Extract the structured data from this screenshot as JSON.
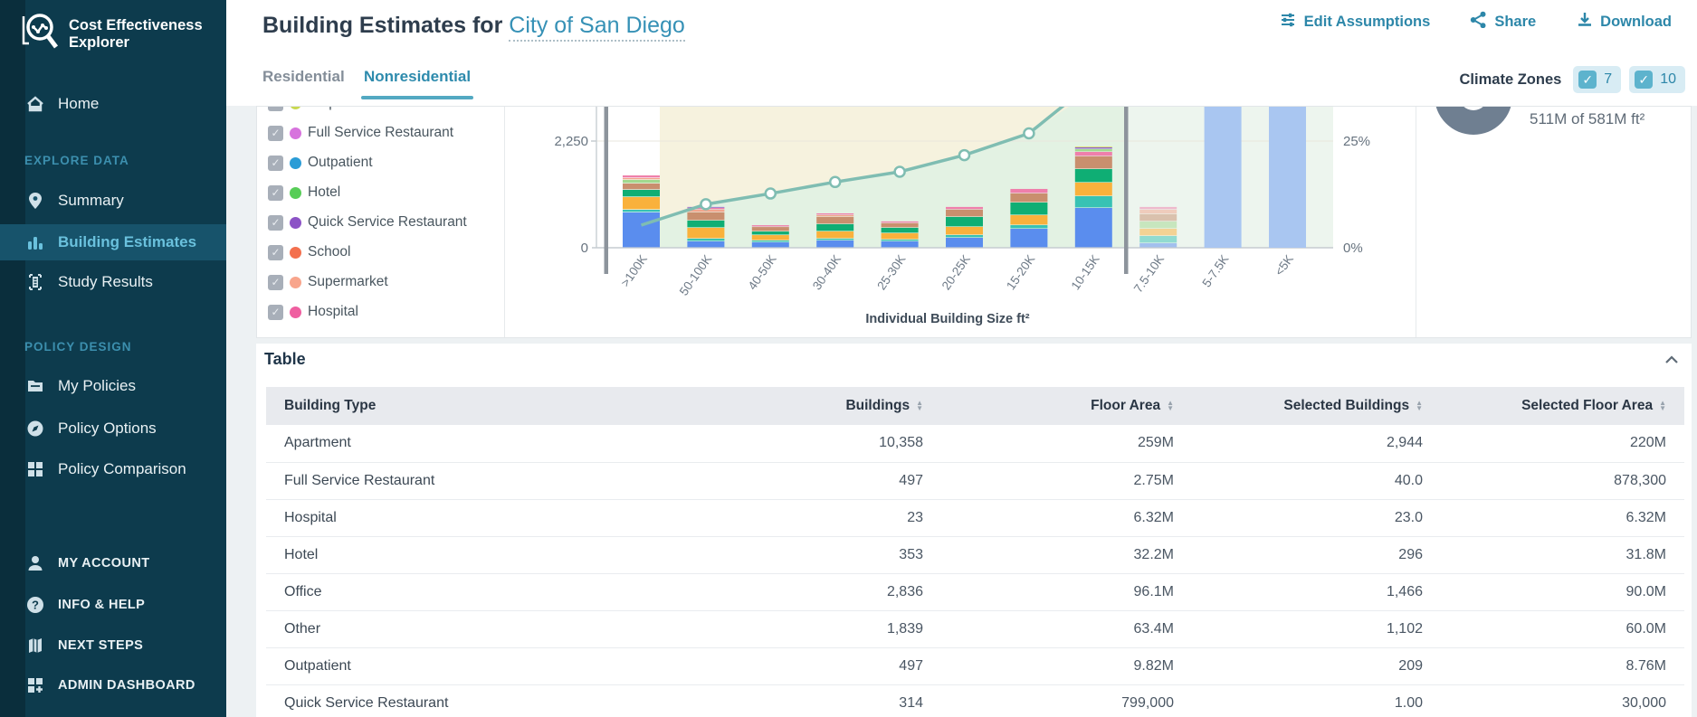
{
  "brand": {
    "line1": "Cost Effectiveness",
    "line2": "Explorer"
  },
  "sidebar": {
    "sections": [
      {
        "label": "",
        "items": [
          {
            "label": "Home",
            "icon": "home-icon",
            "active": false
          }
        ]
      },
      {
        "label": "EXPLORE DATA",
        "items": [
          {
            "label": "Summary",
            "icon": "pin-icon",
            "active": false
          },
          {
            "label": "Building Estimates",
            "icon": "bar-chart-icon",
            "active": true
          },
          {
            "label": "Study Results",
            "icon": "document-icon",
            "active": false
          }
        ]
      },
      {
        "label": "POLICY DESIGN",
        "items": [
          {
            "label": "My Policies",
            "icon": "folder-icon",
            "active": false
          },
          {
            "label": "Policy Options",
            "icon": "compass-icon",
            "active": false
          },
          {
            "label": "Policy Comparison",
            "icon": "grid-icon",
            "active": false
          }
        ]
      }
    ],
    "footer_items": [
      {
        "label": "MY ACCOUNT",
        "icon": "person-icon"
      },
      {
        "label": "INFO & HELP",
        "icon": "question-icon"
      },
      {
        "label": "NEXT STEPS",
        "icon": "map-icon"
      },
      {
        "label": "ADMIN DASHBOARD",
        "icon": "dashboard-plus-icon"
      }
    ]
  },
  "header": {
    "title": "Building Estimates for",
    "region_link": "City of San Diego",
    "actions": [
      {
        "label": "Edit Assumptions",
        "icon": "sliders-icon"
      },
      {
        "label": "Share",
        "icon": "share-icon"
      },
      {
        "label": "Download",
        "icon": "download-icon"
      }
    ]
  },
  "tabs": [
    {
      "label": "Residential",
      "active": false
    },
    {
      "label": "Nonresidential",
      "active": true
    }
  ],
  "climate_zones": {
    "label": "Climate Zones",
    "zones": [
      {
        "value": "7",
        "checked": true
      },
      {
        "value": "10",
        "checked": true
      }
    ]
  },
  "legend": {
    "items": [
      {
        "label": "Strip Mall",
        "color": "#c9d94f",
        "checked": true
      },
      {
        "label": "Full Service Restaurant",
        "color": "#d773dd",
        "checked": true
      },
      {
        "label": "Outpatient",
        "color": "#2b9cd6",
        "checked": true
      },
      {
        "label": "Hotel",
        "color": "#58cd58",
        "checked": true
      },
      {
        "label": "Quick Service Restaurant",
        "color": "#8c53c6",
        "checked": true
      },
      {
        "label": "School",
        "color": "#f3704e",
        "checked": true
      },
      {
        "label": "Supermarket",
        "color": "#f8a58c",
        "checked": true
      },
      {
        "label": "Hospital",
        "color": "#ef5fa0",
        "checked": true
      }
    ]
  },
  "chart_data": {
    "type": "bar",
    "subtype": "stacked-bars-with-cumulative-line",
    "categories": [
      ">100K",
      "50-100K",
      "40-50K",
      "30-40K",
      "25-30K",
      "20-25K",
      "15-20K",
      "10-15K",
      "7.5-10K",
      "5-7.5K",
      "<5K"
    ],
    "xlabel": "Individual Building Size ft²",
    "left_axis": {
      "ticks": [
        "0",
        "2,250"
      ],
      "values": [
        0,
        2250
      ]
    },
    "right_axis": {
      "ticks": [
        "0%",
        "25%"
      ],
      "values": [
        0,
        25
      ]
    },
    "selected_range_note": "slider handles select >100K through 10-15K; bars right of handle are deselected",
    "stack_palette": {
      "blue": "#5a8dee",
      "teal": "#38c2b4",
      "amber": "#f9b13c",
      "green": "#0fae74",
      "tan": "#c98f6e",
      "lgreen": "#a2d98f",
      "salmon": "#f2a58c",
      "pink": "#ef7fab",
      "violet": "#8a5fc9",
      "yellow": "#e0d860"
    },
    "bars": [
      {
        "category": ">100K",
        "total": 1525,
        "segments": [
          [
            "blue",
            744
          ],
          [
            "teal",
            57
          ],
          [
            "amber",
            267
          ],
          [
            "green",
            153
          ],
          [
            "tan",
            134
          ],
          [
            "lgreen",
            76
          ],
          [
            "salmon",
            38
          ],
          [
            "pink",
            56
          ]
        ]
      },
      {
        "category": "50-100K",
        "total": 860,
        "segments": [
          [
            "blue",
            134
          ],
          [
            "teal",
            57
          ],
          [
            "amber",
            229
          ],
          [
            "green",
            153
          ],
          [
            "tan",
            172
          ],
          [
            "salmon",
            57
          ],
          [
            "pink",
            38
          ],
          [
            "violet",
            20
          ]
        ]
      },
      {
        "category": "40-50K",
        "total": 475,
        "segments": [
          [
            "blue",
            114
          ],
          [
            "teal",
            38
          ],
          [
            "amber",
            114
          ],
          [
            "green",
            76
          ],
          [
            "tan",
            95
          ],
          [
            "pink",
            38
          ]
        ]
      },
      {
        "category": "30-40K",
        "total": 725,
        "segments": [
          [
            "blue",
            153
          ],
          [
            "teal",
            38
          ],
          [
            "amber",
            153
          ],
          [
            "green",
            153
          ],
          [
            "tan",
            152
          ],
          [
            "salmon",
            38
          ],
          [
            "pink",
            38
          ]
        ]
      },
      {
        "category": "25-30K",
        "total": 555,
        "segments": [
          [
            "blue",
            134
          ],
          [
            "teal",
            38
          ],
          [
            "amber",
            134
          ],
          [
            "green",
            114
          ],
          [
            "tan",
            97
          ],
          [
            "pink",
            38
          ]
        ]
      },
      {
        "category": "20-25K",
        "total": 860,
        "segments": [
          [
            "blue",
            210
          ],
          [
            "teal",
            57
          ],
          [
            "amber",
            172
          ],
          [
            "green",
            210
          ],
          [
            "tan",
            154
          ],
          [
            "pink",
            57
          ]
        ]
      },
      {
        "category": "15-20K",
        "total": 1240,
        "segments": [
          [
            "blue",
            400
          ],
          [
            "teal",
            76
          ],
          [
            "amber",
            210
          ],
          [
            "green",
            267
          ],
          [
            "tan",
            191
          ],
          [
            "pink",
            96
          ]
        ]
      },
      {
        "category": "10-15K",
        "total": 2135,
        "segments": [
          [
            "blue",
            839
          ],
          [
            "teal",
            248
          ],
          [
            "amber",
            286
          ],
          [
            "green",
            286
          ],
          [
            "tan",
            267
          ],
          [
            "pink",
            95
          ],
          [
            "lgreen",
            57
          ],
          [
            "violet",
            38
          ],
          [
            "yellow",
            19
          ]
        ]
      },
      {
        "category": "7.5-10K",
        "total": 860,
        "muted": true,
        "segments": [
          [
            "blue",
            95
          ],
          [
            "teal",
            153
          ],
          [
            "amber",
            153
          ],
          [
            "lgreen",
            153
          ],
          [
            "tan",
            153
          ],
          [
            "salmon",
            96
          ],
          [
            "pink",
            57
          ]
        ]
      },
      {
        "category": "5-7.5K",
        "total": null,
        "clipped": true
      },
      {
        "category": "<5K",
        "total": null,
        "clipped": true
      }
    ],
    "line": {
      "name": "cumulative floor area %",
      "pct_at_category": [
        5.3,
        10.2,
        12.7,
        15.4,
        17.8,
        21.7,
        26.8,
        null,
        null,
        null,
        null
      ],
      "exits_top_after_index": 6
    },
    "colors": {
      "line": "#7fbdb2",
      "selected_bg_above_line": "#f6f2de",
      "selected_bg_below_line": "#e3f2e3",
      "deselected_bg": "#edf5ee",
      "deselected_bar": "#a9c6f1",
      "handle": "#8d949c"
    }
  },
  "summary_gauge": {
    "value": 511,
    "total": 581,
    "text": "511M of 581M ft²",
    "fill_color": "#6f7f91"
  },
  "table": {
    "section_title": "Table",
    "columns": [
      {
        "label": "Building Type",
        "sortable": true,
        "align": "left"
      },
      {
        "label": "Buildings",
        "sortable": true,
        "align": "right"
      },
      {
        "label": "Floor Area",
        "sortable": true,
        "align": "right"
      },
      {
        "label": "Selected Buildings",
        "sortable": true,
        "align": "right"
      },
      {
        "label": "Selected Floor Area",
        "sortable": true,
        "align": "right"
      }
    ],
    "rows": [
      [
        "Apartment",
        "10,358",
        "259M",
        "2,944",
        "220M"
      ],
      [
        "Full Service Restaurant",
        "497",
        "2.75M",
        "40.0",
        "878,300"
      ],
      [
        "Hospital",
        "23",
        "6.32M",
        "23.0",
        "6.32M"
      ],
      [
        "Hotel",
        "353",
        "32.2M",
        "296",
        "31.8M"
      ],
      [
        "Office",
        "2,836",
        "96.1M",
        "1,466",
        "90.0M"
      ],
      [
        "Other",
        "1,839",
        "63.4M",
        "1,102",
        "60.0M"
      ],
      [
        "Outpatient",
        "497",
        "9.82M",
        "209",
        "8.76M"
      ],
      [
        "Quick Service Restaurant",
        "314",
        "799,000",
        "1.00",
        "30,000"
      ]
    ]
  }
}
